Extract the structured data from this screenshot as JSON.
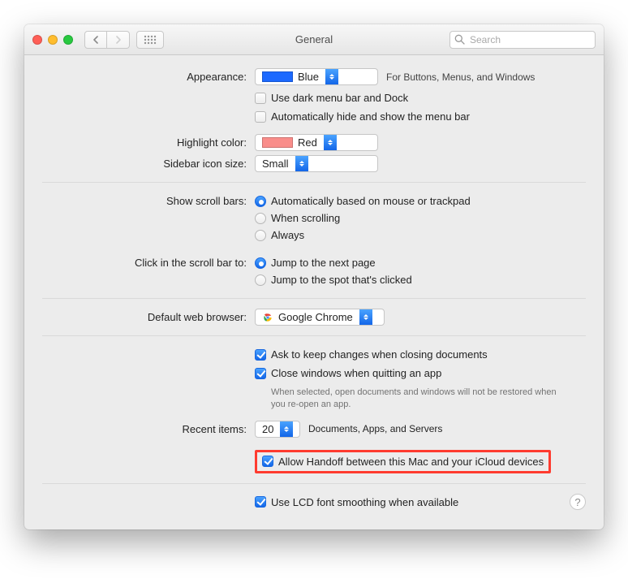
{
  "window": {
    "title": "General"
  },
  "search": {
    "placeholder": "Search"
  },
  "appearance": {
    "label": "Appearance:",
    "value": "Blue",
    "suffix": "For Buttons, Menus, and Windows",
    "darkmenu": "Use dark menu bar and Dock",
    "autohide": "Automatically hide and show the menu bar"
  },
  "highlight": {
    "label": "Highlight color:",
    "value": "Red"
  },
  "sidebar": {
    "label": "Sidebar icon size:",
    "value": "Small"
  },
  "scrollbars": {
    "label": "Show scroll bars:",
    "opts": [
      "Automatically based on mouse or trackpad",
      "When scrolling",
      "Always"
    ]
  },
  "scrollclick": {
    "label": "Click in the scroll bar to:",
    "opts": [
      "Jump to the next page",
      "Jump to the spot that's clicked"
    ]
  },
  "browser": {
    "label": "Default web browser:",
    "value": "Google Chrome"
  },
  "docs": {
    "ask": "Ask to keep changes when closing documents",
    "close": "Close windows when quitting an app",
    "note": "When selected, open documents and windows will not be restored when you re-open an app."
  },
  "recent": {
    "label": "Recent items:",
    "value": "20",
    "suffix": "Documents, Apps, and Servers"
  },
  "handoff": "Allow Handoff between this Mac and your iCloud devices",
  "lcd": "Use LCD font smoothing when available"
}
